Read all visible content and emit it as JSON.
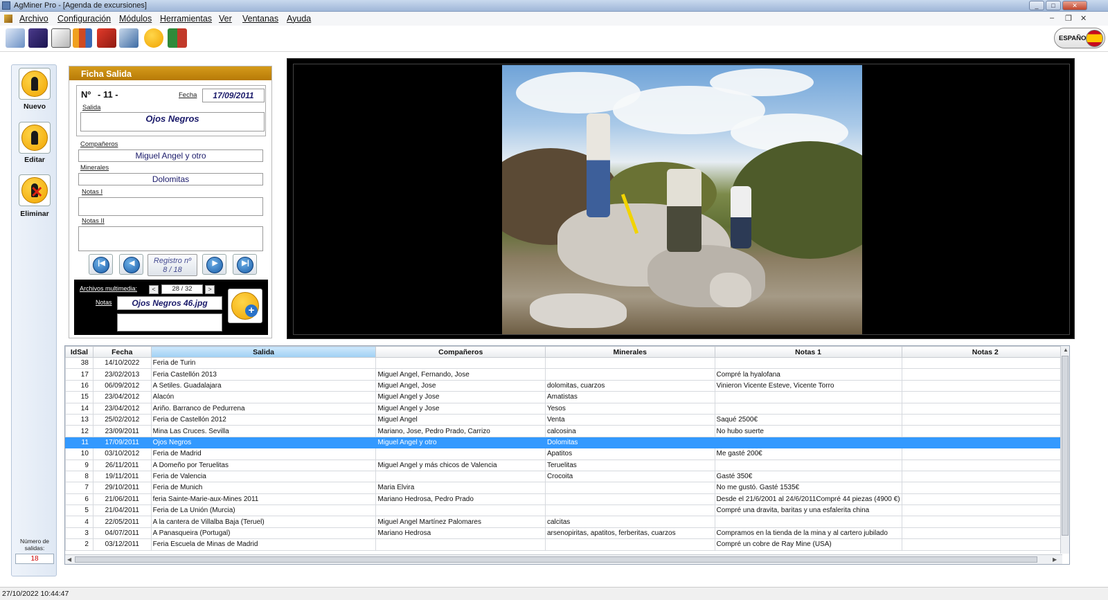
{
  "window": {
    "title": "AgMiner Pro - [Agenda de excursiones]",
    "controls": [
      "_",
      "□",
      "✕"
    ]
  },
  "menu": {
    "items": [
      "Archivo",
      "Configuración",
      "Módulos",
      "Herramientas",
      "Ver",
      "Ventanas",
      "Ayuda"
    ]
  },
  "toolbar": {
    "icons": [
      "map-icon",
      "crystal-icon",
      "gem-icon",
      "books-icon",
      "hammer-icon",
      "tools-icon",
      "miner-icon",
      "book-icon"
    ],
    "language_label": "ESPAÑOL"
  },
  "actions": {
    "new_label": "Nuevo",
    "edit_label": "Editar",
    "delete_label": "Eliminar",
    "count_label": "Número de salidas:",
    "count_value": "18"
  },
  "ficha": {
    "header": "Ficha Salida",
    "number_label": "Nº",
    "number_value": "- 11 -",
    "date_label": "Fecha",
    "date_value": "17/09/2011",
    "salida_label": "Salida",
    "salida_value": "Ojos Negros",
    "companeros_label": "Compañeros",
    "companeros_value": "Miguel Angel y otro",
    "minerales_label": "Minerales",
    "minerales_value": "Dolomitas",
    "notas1_label": "Notas I",
    "notas1_value": "",
    "notas2_label": "Notas II",
    "notas2_value": "",
    "registro_line1": "Registro nº",
    "registro_line2": "8 / 18",
    "media_label": "Archivos multimedia:",
    "media_counter": "28 / 32",
    "media_notes_label": "Notas",
    "media_file": "Ojos Negros 46.jpg",
    "media_prev": "<",
    "media_next": ">"
  },
  "grid": {
    "columns": [
      "IdSal",
      "Fecha",
      "Salida",
      "Compañeros",
      "Minerales",
      "Notas 1",
      "Notas 2"
    ],
    "rows": [
      [
        "38",
        "14/10/2022",
        "Feria de Turin",
        "",
        "",
        "",
        ""
      ],
      [
        "17",
        "23/02/2013",
        "Feria Castellón 2013",
        "Miguel Angel, Fernando, Jose",
        "",
        "Compré la hyalofana",
        ""
      ],
      [
        "16",
        "06/09/2012",
        "A Setiles. Guadalajara",
        "Miguel Angel, Jose",
        "dolomitas, cuarzos",
        "Vinieron Vicente Esteve, Vicente Torro",
        ""
      ],
      [
        "15",
        "23/04/2012",
        "Alacón",
        "Miguel Angel y Jose",
        "Amatistas",
        "",
        ""
      ],
      [
        "14",
        "23/04/2012",
        "Ariño. Barranco de Pedurrena",
        "Miguel Angel y Jose",
        "Yesos",
        "",
        ""
      ],
      [
        "13",
        "25/02/2012",
        "Feria de Castellón 2012",
        "Miguel Angel",
        "Venta",
        "Saqué 2500€",
        ""
      ],
      [
        "12",
        "23/09/2011",
        "Mina Las Cruces. Sevilla",
        "Mariano, Jose, Pedro Prado, Carrizo",
        "calcosina",
        "No hubo suerte",
        ""
      ],
      [
        "11",
        "17/09/2011",
        "Ojos Negros",
        "Miguel Angel y otro",
        "Dolomitas",
        "",
        ""
      ],
      [
        "10",
        "03/10/2012",
        "Feria de Madrid",
        "",
        "Apatitos",
        "Me gasté 200€",
        ""
      ],
      [
        "9",
        "26/11/2011",
        "A Domeño por Teruelitas",
        "Miguel Angel  y más chicos de Valencia",
        "Teruelitas",
        "",
        ""
      ],
      [
        "8",
        "19/11/2011",
        "Feria de Valencia",
        "",
        "Crocoita",
        "Gasté 350€",
        ""
      ],
      [
        "7",
        "29/10/2011",
        "Feria de Munich",
        "Maria Elvira",
        "",
        "No me gustó. Gasté 1535€",
        ""
      ],
      [
        "6",
        "21/06/2011",
        "feria Sainte-Marie-aux-Mines 2011",
        "Mariano Hedrosa, Pedro Prado",
        "",
        "Desde el 21/6/2001 al 24/6/2011Compré 44 piezas (4900 €)",
        ""
      ],
      [
        "5",
        "21/04/2011",
        "Feria de La Unión (Murcia)",
        "",
        "",
        "Compré una dravita, baritas y una esfalerita china",
        ""
      ],
      [
        "4",
        "22/05/2011",
        "A la cantera de Villalba Baja (Teruel)",
        "Miguel Angel Martínez Palomares",
        "calcitas",
        "",
        ""
      ],
      [
        "3",
        "04/07/2011",
        "A Panasqueira (Portugal)",
        "Mariano Hedrosa",
        "arsenopiritas, apatitos, ferberitas, cuarzos",
        "Compramos en la tienda de la mina y al cartero jubilado",
        ""
      ],
      [
        "2",
        "03/12/2011",
        "Feria Escuela de Minas de Madrid",
        "",
        "",
        "Compré un cobre de Ray Mine (USA)",
        ""
      ]
    ],
    "selected_id": "11"
  },
  "status": {
    "datetime": "27/10/2022 10:44:47"
  }
}
